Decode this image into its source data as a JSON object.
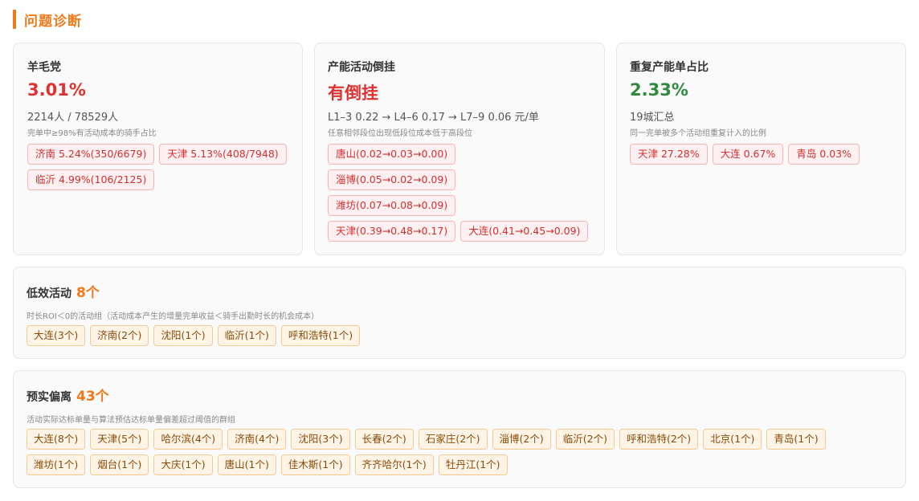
{
  "header": {
    "title": "问题诊断"
  },
  "wool_party": {
    "title": "羊毛党",
    "value": "3.01%",
    "sub": "2214人 / 78529人",
    "desc": "完单中≥98%有活动成本的骑手占比",
    "tags": [
      "济南 5.24%(350/6679)",
      "天津 5.13%(408/7948)",
      "临沂 4.99%(106/2125)"
    ]
  },
  "capacity_inversion": {
    "title": "产能活动倒挂",
    "value": "有倒挂",
    "sub": "L1–3 0.22 → L4–6 0.17 → L7–9 0.06 元/单",
    "desc": "任意相邻段位出现低段位成本低于高段位",
    "tags": [
      "唐山(0.02→0.03→0.00)",
      "淄博(0.05→0.02→0.09)",
      "潍坊(0.07→0.08→0.09)",
      "天津(0.39→0.48→0.17)",
      "大连(0.41→0.45→0.09)"
    ]
  },
  "duplicate_capacity": {
    "title": "重复产能单占比",
    "value": "2.33%",
    "sub": "19城汇总",
    "desc": "同一完单被多个活动组重复计入的比例",
    "tags": [
      "天津 27.28%",
      "大连 0.67%",
      "青岛 0.03%"
    ]
  },
  "low_efficiency": {
    "title": "低效活动",
    "count": "8个",
    "desc": "时长ROI＜0的活动组（活动成本产生的增量完单收益＜骑手出勤时长的机会成本）",
    "tags": [
      "大连(3个)",
      "济南(2个)",
      "沈阳(1个)",
      "临沂(1个)",
      "呼和浩特(1个)"
    ]
  },
  "forecast_deviation": {
    "title": "预实偏离",
    "count": "43个",
    "desc": "活动实际达标单量与算法预估达标单量偏差超过阈值的群组",
    "tags": [
      "大连(8个)",
      "天津(5个)",
      "哈尔滨(4个)",
      "济南(4个)",
      "沈阳(3个)",
      "长春(2个)",
      "石家庄(2个)",
      "淄博(2个)",
      "临沂(2个)",
      "呼和浩特(2个)",
      "北京(1个)",
      "青岛(1个)",
      "潍坊(1个)",
      "烟台(1个)",
      "大庆(1个)",
      "唐山(1个)",
      "佳木斯(1个)",
      "齐齐哈尔(1个)",
      "牡丹江(1个)"
    ]
  },
  "colors": {
    "accent": "#f07a1a",
    "red": "#e03131",
    "green": "#2f8a3e"
  }
}
